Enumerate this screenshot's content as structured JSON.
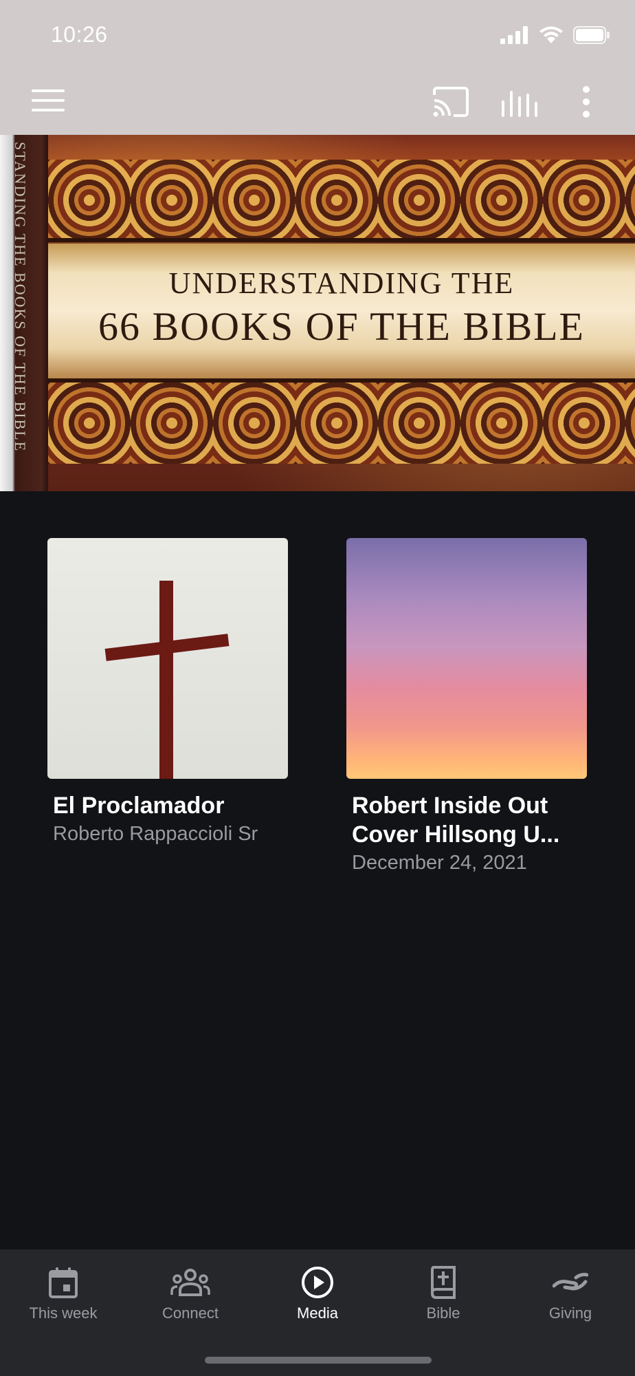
{
  "status_bar": {
    "time": "10:26"
  },
  "app_bar": {
    "icons": [
      "menu-icon",
      "cast-icon",
      "equalizer-icon",
      "more-vert-icon"
    ]
  },
  "hero": {
    "spine_text": "STANDING THE BOOKS OF THE BIBLE",
    "title_line1": "UNDERSTANDING THE",
    "title_line2": "66 BOOKS OF THE BIBLE"
  },
  "media_cards": [
    {
      "title": "El Proclamador",
      "subtitle": "Roberto Rappaccioli Sr"
    },
    {
      "title": "Robert Inside Out Cover Hillsong U...",
      "subtitle": "December 24, 2021"
    }
  ],
  "bottom_nav": [
    {
      "label": "This week",
      "icon": "calendar-icon",
      "active": false
    },
    {
      "label": "Connect",
      "icon": "groups-icon",
      "active": false
    },
    {
      "label": "Media",
      "icon": "play-circle-icon",
      "active": true
    },
    {
      "label": "Bible",
      "icon": "bible-icon",
      "active": false
    },
    {
      "label": "Giving",
      "icon": "giving-icon",
      "active": false
    }
  ],
  "colors": {
    "background": "#121316",
    "top_bar": "#d1cbcb",
    "bottom_nav": "#26272b",
    "nav_inactive": "#9b9ca2",
    "nav_active": "#ffffff"
  }
}
